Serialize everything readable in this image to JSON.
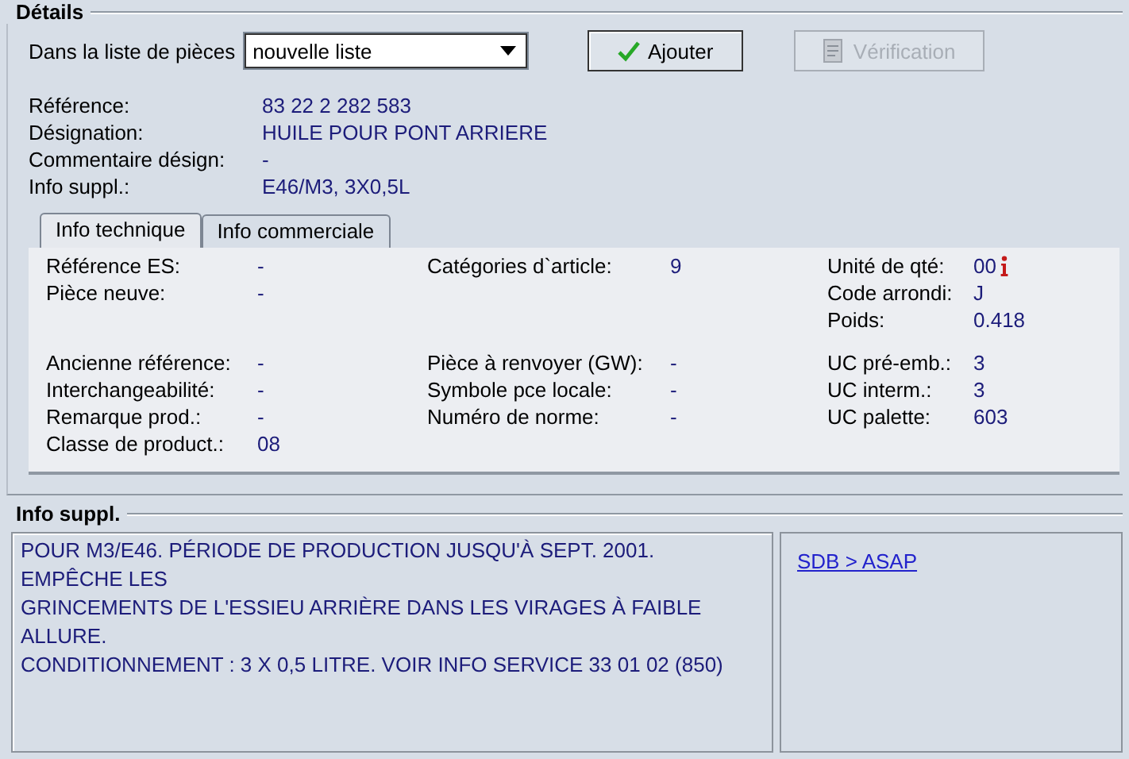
{
  "details": {
    "title": "Détails",
    "list_label": "Dans la liste de pièces",
    "list_value": "nouvelle liste",
    "buttons": [
      {
        "label": "Ajouter",
        "kind": "add",
        "disabled": false
      },
      {
        "label": "Vérification",
        "kind": "check",
        "disabled": true
      }
    ],
    "fields": [
      {
        "label": "Référence:",
        "value": "83 22 2 282 583"
      },
      {
        "label": "Désignation:",
        "value": "HUILE POUR PONT ARRIERE"
      },
      {
        "label": "Commentaire désign:",
        "value": "-"
      },
      {
        "label": "Info suppl.:",
        "value": "E46/M3, 3X0,5L"
      }
    ],
    "tabs": [
      {
        "label": "Info technique",
        "selected": true
      },
      {
        "label": "Info commerciale",
        "selected": false
      }
    ],
    "groups": [
      {
        "columns": [
          [
            {
              "label": "Référence ES:",
              "value": "-"
            },
            {
              "label": "Pièce neuve:",
              "value": "-"
            }
          ],
          [
            {
              "label": "Catégories d`article:",
              "value": "9"
            }
          ],
          [
            {
              "label": "Unité de qté:",
              "value": "00",
              "info": true
            },
            {
              "label": "Code arrondi:",
              "value": "J"
            },
            {
              "label": "Poids:",
              "value": "0.418"
            }
          ]
        ]
      },
      {
        "columns": [
          [
            {
              "label": "Ancienne référence:",
              "value": "-"
            },
            {
              "label": "Interchangeabilité:",
              "value": "-"
            },
            {
              "label": "Remarque prod.:",
              "value": "-"
            },
            {
              "label": "Classe de product.:",
              "value": "08"
            }
          ],
          [
            {
              "label": "Pièce à renvoyer (GW):",
              "value": "-"
            },
            {
              "label": "Symbole pce locale:",
              "value": "-"
            },
            {
              "label": "Numéro de norme:",
              "value": "-"
            }
          ],
          [
            {
              "label": "UC pré-emb.:",
              "value": "3"
            },
            {
              "label": "UC interm.:",
              "value": "3"
            },
            {
              "label": "UC palette:",
              "value": "603"
            }
          ]
        ]
      }
    ]
  },
  "info_suppl": {
    "title": "Info suppl.",
    "lines": [
      "POUR M3/E46. PÉRIODE DE PRODUCTION JUSQU'À SEPT. 2001.",
      "EMPÊCHE LES",
      "GRINCEMENTS DE L'ESSIEU ARRIÈRE DANS LES VIRAGES À FAIBLE",
      "ALLURE.",
      "CONDITIONNEMENT : 3 X 0,5 LITRE. VOIR INFO SERVICE 33 01 02 (850)"
    ],
    "link": "SDB > ASAP"
  }
}
